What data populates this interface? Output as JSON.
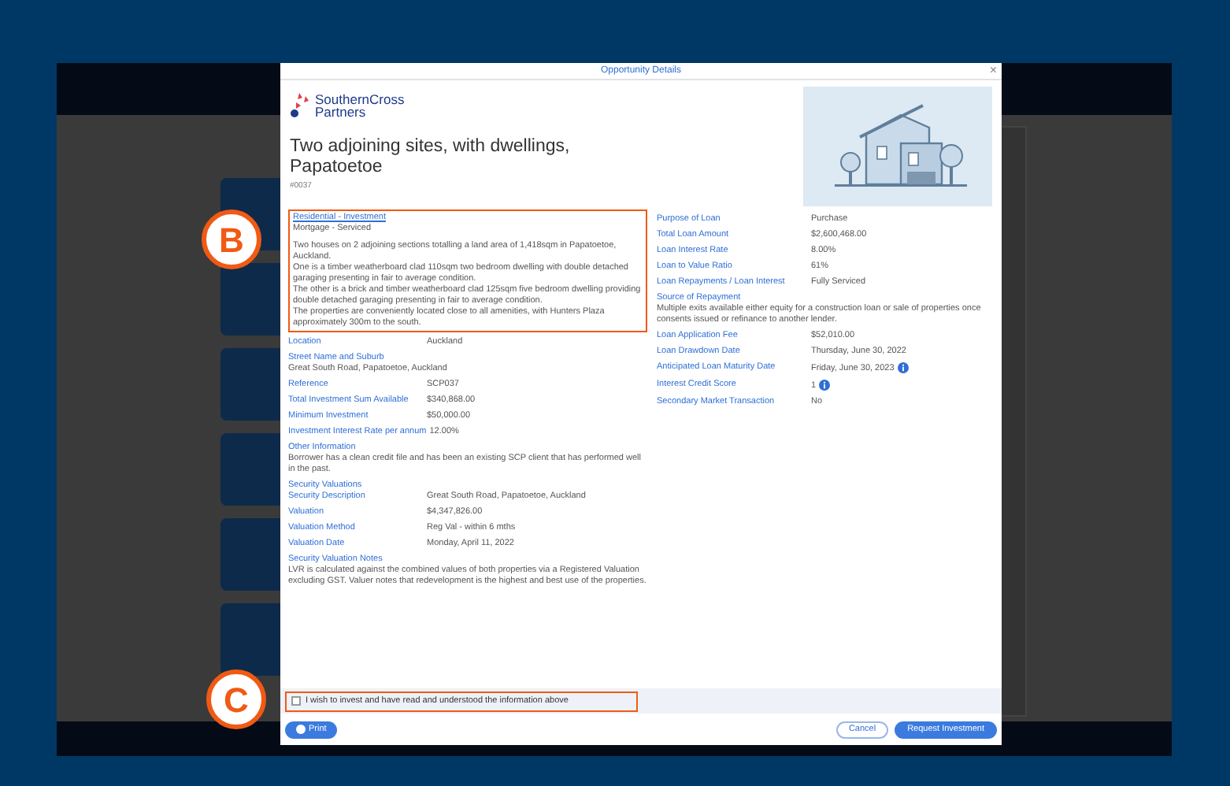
{
  "dialog": {
    "title": "Opportunity Details",
    "close": "×"
  },
  "logo": {
    "name": "SouthernCross",
    "name_line2": "Partners"
  },
  "heading": "Two adjoining sites, with dwellings, Papatoetoe",
  "reference_code": "#0037",
  "summary": {
    "category": "Residential - Investment",
    "subtitle": "Mortgage - Serviced",
    "paragraphs": [
      "Two houses on 2 adjoining sections totalling a land area of 1,418sqm in Papatoetoe, Auckland.",
      "One is a timber weatherboard clad 110sqm two bedroom dwelling with double detached garaging presenting in fair to average condition.",
      "The other is a brick and timber weatherboard clad 125sqm five bedroom dwelling providing double detached garaging presenting in fair to average condition.",
      "The properties are conveniently located close to all amenities, with Hunters Plaza approximately 300m to the south."
    ]
  },
  "left_details": [
    {
      "kind": "pair",
      "label": "Location",
      "value": "Auckland"
    },
    {
      "kind": "block",
      "label": "Street Name and Suburb",
      "value": "Great South Road, Papatoetoe, Auckland"
    },
    {
      "kind": "pair",
      "label": "Reference",
      "value": "SCP037"
    },
    {
      "kind": "pair",
      "label": "Total Investment Sum Available",
      "value": "$340,868.00"
    },
    {
      "kind": "pair",
      "label": "Minimum Investment",
      "value": "$50,000.00"
    },
    {
      "kind": "inline",
      "label": "Investment Interest Rate per annum",
      "value": "12.00%"
    },
    {
      "kind": "block",
      "label": "Other Information",
      "value": "Borrower has a clean credit file and has been an existing SCP client that has performed well in the past."
    },
    {
      "kind": "heading",
      "label": "Security Valuations"
    },
    {
      "kind": "pair",
      "label": "Security Description",
      "value": "Great South Road, Papatoetoe, Auckland"
    },
    {
      "kind": "pair",
      "label": "Valuation",
      "value": "$4,347,826.00"
    },
    {
      "kind": "pair",
      "label": "Valuation Method",
      "value": "Reg Val - within 6 mths"
    },
    {
      "kind": "pair",
      "label": "Valuation Date",
      "value": "Monday, April 11, 2022"
    },
    {
      "kind": "block",
      "label": "Security Valuation Notes",
      "value": "LVR is calculated against the combined values of both properties via a Registered Valuation excluding GST. Valuer notes that redevelopment is the highest and best use of the properties."
    }
  ],
  "right_details": [
    {
      "kind": "pair",
      "label": "Purpose of Loan",
      "value": "Purchase",
      "info": false
    },
    {
      "kind": "pair",
      "label": "Total Loan Amount",
      "value": "$2,600,468.00",
      "info": false
    },
    {
      "kind": "pair",
      "label": "Loan Interest Rate",
      "value": "8.00%",
      "info": false
    },
    {
      "kind": "pair",
      "label": "Loan to Value Ratio",
      "value": "61%",
      "info": false
    },
    {
      "kind": "pair",
      "label": "Loan Repayments / Loan Interest",
      "value": "Fully Serviced",
      "info": false
    },
    {
      "kind": "block",
      "label": "Source of Repayment",
      "value": "Multiple exits available either equity for a construction loan or sale of properties once consents issued or refinance to another lender.",
      "info": false
    },
    {
      "kind": "pair",
      "label": "Loan Application Fee",
      "value": "$52,010.00",
      "info": false
    },
    {
      "kind": "pair",
      "label": "Loan Drawdown Date",
      "value": "Thursday, June 30, 2022",
      "info": false
    },
    {
      "kind": "pair",
      "label": "Anticipated Loan Maturity Date",
      "value": "Friday, June 30, 2023",
      "info": true
    },
    {
      "kind": "pair",
      "label": "Interest Credit Score",
      "value": "1",
      "info": true
    },
    {
      "kind": "pair",
      "label": "Secondary Market Transaction",
      "value": "No",
      "info": false
    }
  ],
  "agreement": {
    "label": "I wish to invest and have read and understood the information above",
    "checked": false
  },
  "buttons": {
    "print": "Print",
    "cancel": "Cancel",
    "submit": "Request Investment"
  },
  "annotations": [
    {
      "label": "B"
    },
    {
      "label": "C"
    }
  ]
}
